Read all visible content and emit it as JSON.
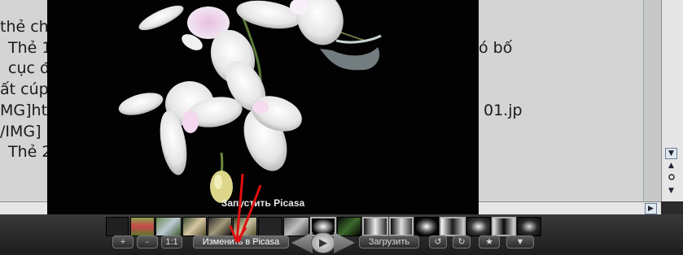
{
  "editor": {
    "lines": [
      "thẻ ch",
      "Thẻ 1",
      "cục đ",
      "ất cúp",
      "MG]ht",
      "/IMG]",
      "Thẻ 2"
    ],
    "right_fragments": [
      "ó bố",
      "01.jp"
    ]
  },
  "viewer": {
    "launch_label": "Запустить Picasa"
  },
  "controls": {
    "zoom_in": "+",
    "zoom_out": "-",
    "actual_size": "1:1",
    "edit_in_picasa": "Изменить в Picasa",
    "upload": "Загрузить",
    "rotate_left": "↺",
    "rotate_right": "↻",
    "star": "★",
    "more": "▼",
    "play": "▶"
  },
  "scrollbars": {
    "up": "▲",
    "down": "▼",
    "right": "▶"
  },
  "colors": {
    "editor_bg": "#d4d4d4",
    "viewer_bg": "#020202",
    "annotation_arrow": "#e01010"
  }
}
